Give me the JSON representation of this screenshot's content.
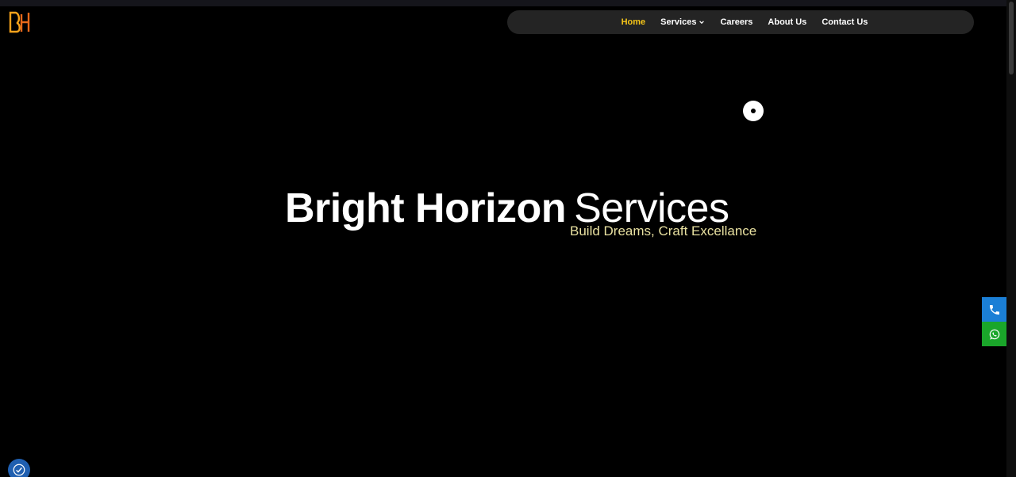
{
  "brand": {
    "logo_text": "BH",
    "logo_color": "#f5a21b"
  },
  "nav": {
    "items": [
      {
        "label": "Home",
        "active": true
      },
      {
        "label": "Services",
        "has_dropdown": true
      },
      {
        "label": "Careers"
      },
      {
        "label": "About Us"
      },
      {
        "label": "Contact Us"
      }
    ],
    "active_color": "#f5c518"
  },
  "hero": {
    "title_bold": "Bright Horizon",
    "title_light": "Services",
    "subtitle": "Build Dreams, Craft Excellance",
    "subtitle_color": "#e8e0a0"
  },
  "floating": {
    "phone_icon": "phone-icon",
    "whatsapp_icon": "whatsapp-icon",
    "phone_color": "#1b7fd6",
    "whatsapp_color": "#1aa62a",
    "accessibility_icon": "accessibility-icon"
  }
}
